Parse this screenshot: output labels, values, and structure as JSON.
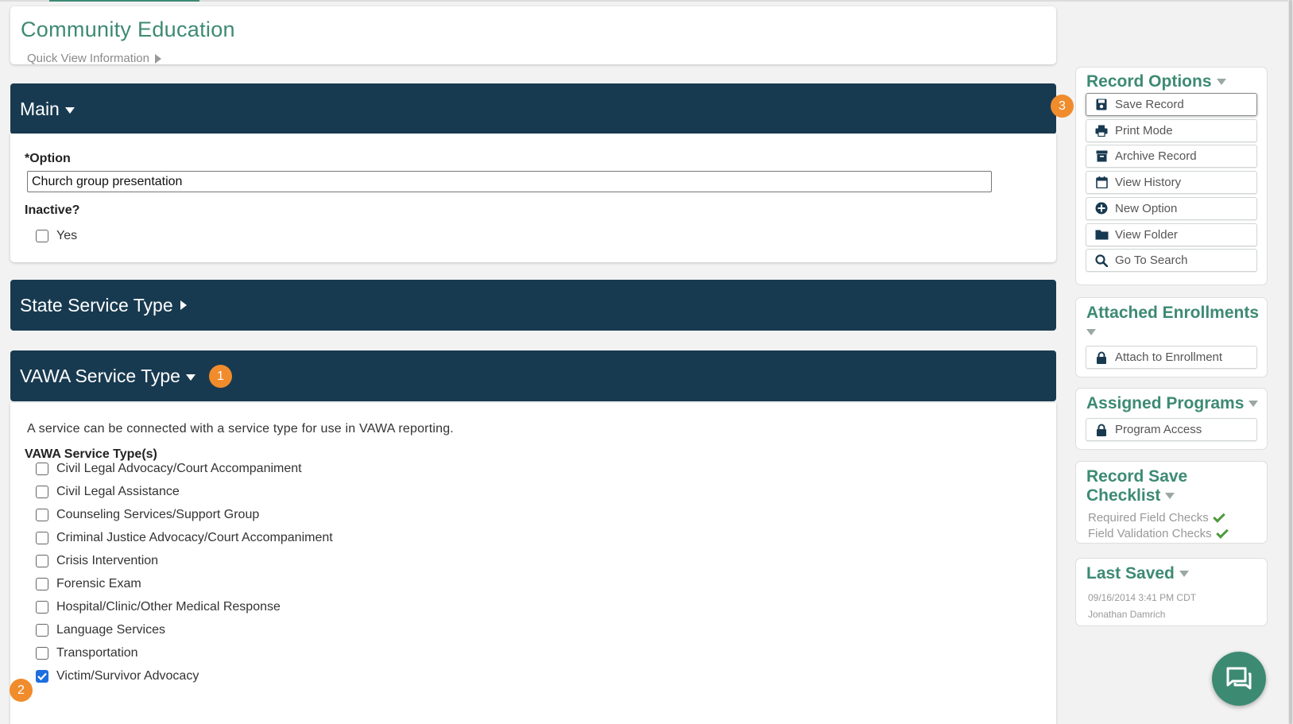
{
  "page": {
    "title": "Community Education",
    "quick_view": "Quick View Information"
  },
  "main_section": {
    "title": "Main",
    "option_label": "*Option",
    "option_value": "Church group presentation",
    "inactive_label": "Inactive?",
    "inactive_yes": "Yes"
  },
  "state_section": {
    "title": "State Service Type"
  },
  "vawa_section": {
    "title": "VAWA Service Type",
    "description": "A service can be connected with a service type for use in VAWA reporting.",
    "types_label": "VAWA Service Type(s)",
    "types": [
      {
        "label": "Civil Legal Advocacy/Court Accompaniment",
        "checked": false
      },
      {
        "label": "Civil Legal Assistance",
        "checked": false
      },
      {
        "label": "Counseling Services/Support Group",
        "checked": false
      },
      {
        "label": "Criminal Justice Advocacy/Court Accompaniment",
        "checked": false
      },
      {
        "label": "Crisis Intervention",
        "checked": false
      },
      {
        "label": "Forensic Exam",
        "checked": false
      },
      {
        "label": "Hospital/Clinic/Other Medical Response",
        "checked": false
      },
      {
        "label": "Language Services",
        "checked": false
      },
      {
        "label": "Transportation",
        "checked": false
      },
      {
        "label": "Victim/Survivor Advocacy",
        "checked": true
      }
    ]
  },
  "markers": {
    "m1": "1",
    "m2": "2",
    "m3": "3"
  },
  "record_options": {
    "title": "Record Options",
    "buttons": [
      {
        "label": "Save Record",
        "icon": "save-icon"
      },
      {
        "label": "Print Mode",
        "icon": "printer-icon"
      },
      {
        "label": "Archive Record",
        "icon": "archive-icon"
      },
      {
        "label": "View History",
        "icon": "calendar-icon"
      },
      {
        "label": "New Option",
        "icon": "plus-circle-icon"
      },
      {
        "label": "View Folder",
        "icon": "folder-icon"
      },
      {
        "label": "Go To Search",
        "icon": "search-icon"
      }
    ]
  },
  "attached_enrollments": {
    "title": "Attached Enrollments",
    "button": "Attach to Enrollment"
  },
  "assigned_programs": {
    "title": "Assigned Programs",
    "button": "Program Access"
  },
  "save_checklist": {
    "title_line1": "Record Save",
    "title_line2": "Checklist",
    "items": [
      "Required Field Checks",
      "Field Validation Checks"
    ]
  },
  "last_saved": {
    "title": "Last Saved",
    "timestamp": "09/16/2014 3:41 PM CDT",
    "user": "Jonathan Damrich"
  },
  "colors": {
    "accent_green": "#3d8a73",
    "header_navy": "#183a50",
    "marker_orange": "#f08c2c",
    "checkbox_blue": "#1d6fe0"
  }
}
